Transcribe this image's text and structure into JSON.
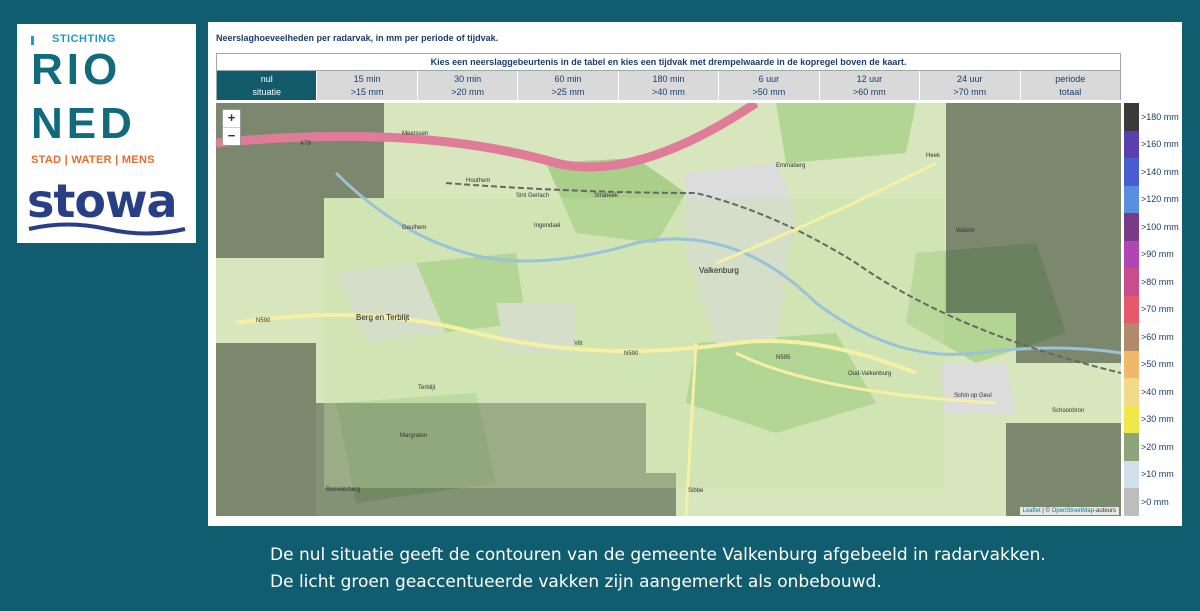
{
  "logo": {
    "rioned_small": "STICHTING",
    "rioned_line1": "RIO",
    "rioned_line2": "NED",
    "rioned_tagline": "STAD | WATER | MENS",
    "stowa": "stowa"
  },
  "panel": {
    "title": "Neerslaghoeveelheden per radarvak, in mm per periode of tijdvak.",
    "instruction": "Kies een neerslaggebeurtenis in de tabel en kies een tijdvak met drempelwaarde in de kopregel boven de kaart."
  },
  "columns": [
    {
      "line1": "nul",
      "line2": "situatie",
      "active": true
    },
    {
      "line1": "15 min",
      "line2": ">15 mm"
    },
    {
      "line1": "30 min",
      "line2": ">20 mm"
    },
    {
      "line1": "60 min",
      "line2": ">25 mm"
    },
    {
      "line1": "180 min",
      "line2": ">40 mm"
    },
    {
      "line1": "6 uur",
      "line2": ">50 mm"
    },
    {
      "line1": "12 uur",
      "line2": ">60 mm"
    },
    {
      "line1": "24 uur",
      "line2": ">70 mm"
    },
    {
      "line1": "periode",
      "line2": "totaal"
    }
  ],
  "map": {
    "zoom_in": "+",
    "zoom_out": "−",
    "attribution_leaflet": "Leaflet",
    "attribution_sep": " | © ",
    "attribution_osm": "OpenStreetMap",
    "attribution_suffix": "-auteurs",
    "labels": {
      "valkenburg": "Valkenburg",
      "berg_en_terblijt": "Berg en Terblijt",
      "schin_op_geul": "Schin op Geul",
      "sint_gerlach": "Sint Gerlach",
      "houthem": "Houthem",
      "meerssen": "Meerssen",
      "vilt": "Vilt",
      "sibbe": "Sibbe",
      "n590": "N590",
      "n595": "N595",
      "a79": "A79",
      "emmaberg": "Emmaberg",
      "walem": "Walem",
      "heek": "Heek",
      "terblijt": "Terblijt",
      "margraten": "Margraten",
      "bemelerberg": "Bemelerberg",
      "oud_valkenburg": "Oud-Valkenburg",
      "schoonbron": "Schoonbron",
      "geulhem": "Geulhem",
      "ingendael": "Ingendael",
      "strabeek": "Strabeek"
    }
  },
  "legend": [
    {
      "label": ">180 mm",
      "color": "#3a3a3a"
    },
    {
      "label": ">160 mm",
      "color": "#5a3fb0"
    },
    {
      "label": ">140 mm",
      "color": "#4a5fcf"
    },
    {
      "label": ">120 mm",
      "color": "#5a8fe0"
    },
    {
      "label": ">100 mm",
      "color": "#7a3a8a"
    },
    {
      "label": ">90 mm",
      "color": "#b046b6"
    },
    {
      "label": ">80 mm",
      "color": "#c94d8a"
    },
    {
      "label": ">70 mm",
      "color": "#e55a6a"
    },
    {
      "label": ">60 mm",
      "color": "#b28a6a"
    },
    {
      "label": ">50 mm",
      "color": "#f0b868"
    },
    {
      "label": ">40 mm",
      "color": "#f2d98a"
    },
    {
      "label": ">30 mm",
      "color": "#efe84a"
    },
    {
      "label": ">20 mm",
      "color": "#8ea37a"
    },
    {
      "label": ">10 mm",
      "color": "#cfe0ea"
    },
    {
      "label": ">0 mm",
      "color": "#bdbdbd"
    }
  ],
  "caption": {
    "line1": "De nul situatie geeft de contouren van de gemeente Valkenburg afgebeeld in radarvakken.",
    "line2": "De licht groen geaccentueerde vakken zijn aangemerkt als onbebouwd."
  }
}
